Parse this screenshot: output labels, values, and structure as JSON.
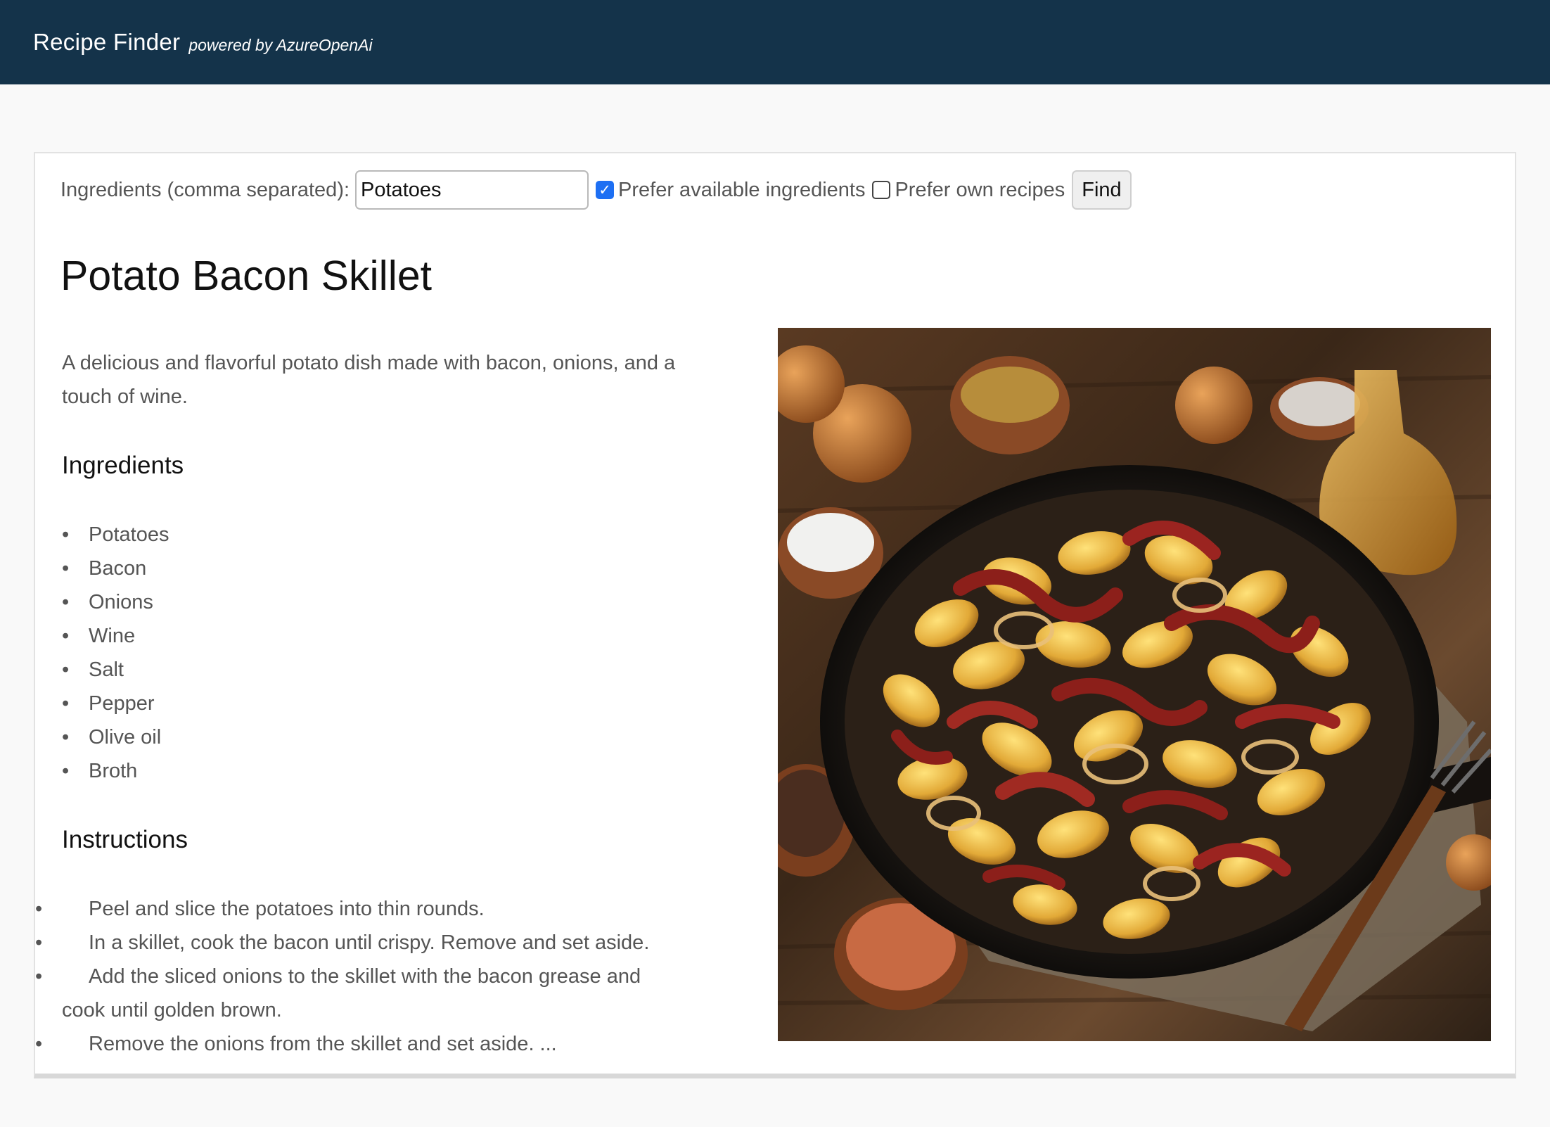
{
  "header": {
    "brand": "Recipe Finder",
    "tagline": "powered by AzureOpenAi"
  },
  "search": {
    "label": "Ingredients (comma separated):",
    "value": "Potatoes",
    "prefer_available_label": "Prefer available ingredients",
    "prefer_available_checked": true,
    "prefer_own_label": "Prefer own recipes",
    "prefer_own_checked": false,
    "find_label": "Find"
  },
  "recipe": {
    "title": "Potato Bacon Skillet",
    "description": "A delicious and flavorful potato dish made with bacon, onions, and a touch of wine.",
    "ingredients_title": "Ingredients",
    "ingredients": [
      "Potatoes",
      "Bacon",
      "Onions",
      "Wine",
      "Salt",
      "Pepper",
      "Olive oil",
      "Broth"
    ],
    "instructions_title": "Instructions",
    "instructions": [
      "Peel and slice the potatoes into thin rounds.",
      "In a skillet, cook the bacon until crispy. Remove and set aside.",
      "Add the sliced onions to the skillet with the bacon grease and cook until golden brown.",
      "Remove the onions from the skillet and set aside. ..."
    ],
    "image": "recipe-photo"
  },
  "colors": {
    "header_bg": "#14334a",
    "checkbox_accent": "#1d6ff3"
  }
}
